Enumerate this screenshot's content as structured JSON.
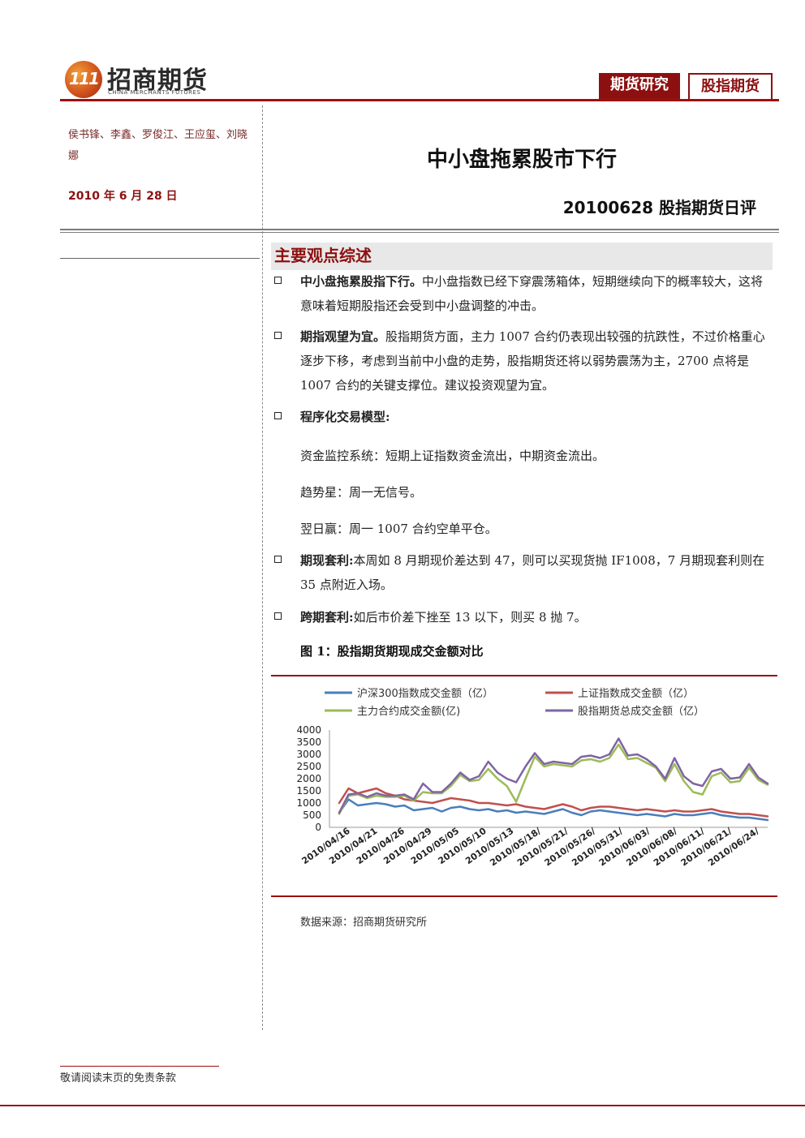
{
  "header": {
    "logo_mark": "111",
    "logo_cn": "招商期货",
    "logo_en": "CHINA MERCHANTS FUTURES",
    "tag1": "期货研究",
    "tag2": "股指期货"
  },
  "left": {
    "authors": "侯书锋、李鑫、罗俊江、王应玺、刘晓娜",
    "date": "2010 年 6 月 28 日"
  },
  "title": "中小盘拖累股市下行",
  "subtitle": "20100628 股指期货日评",
  "section_title": "主要观点综述",
  "points": [
    {
      "head": "中小盘拖累股指下行。",
      "body": "中小盘指数已经下穿震荡箱体，短期继续向下的概率较大，这将意味着短期股指还会受到中小盘调整的冲击。"
    },
    {
      "head": "期指观望为宜。",
      "body": "股指期货方面，主力 1007 合约仍表现出较强的抗跌性，不过价格重心逐步下移，考虑到当前中小盘的走势，股指期货还将以弱势震荡为主，2700 点将是 1007 合约的关键支撑位。建议投资观望为宜。"
    },
    {
      "head": "程序化交易模型:",
      "body": ""
    },
    {
      "head": "期现套利:",
      "body": "本周如 8 月期现价差达到 47，则可以买现货抛 IF1008，7 月期现套利则在 35 点附近入场。"
    },
    {
      "head": "跨期套利:",
      "body": "如后市价差下挫至 13 以下，则买 8 抛 7。"
    }
  ],
  "models": [
    "资金监控系统：短期上证指数资金流出，中期资金流出。",
    "趋势星：周一无信号。",
    "翌日赢：周一 1007 合约空单平仓。"
  ],
  "figure": {
    "title": "图 1：股指期货期现成交金额对比",
    "source": "数据来源：招商期货研究所"
  },
  "footer": "敬请阅读末页的免责条款",
  "chart_data": {
    "type": "line",
    "x": [
      "2010/04/16",
      "2010/04/19",
      "2010/04/20",
      "2010/04/21",
      "2010/04/22",
      "2010/04/23",
      "2010/04/26",
      "2010/04/27",
      "2010/04/28",
      "2010/04/29",
      "2010/04/30",
      "2010/05/04",
      "2010/05/05",
      "2010/05/06",
      "2010/05/07",
      "2010/05/10",
      "2010/05/11",
      "2010/05/12",
      "2010/05/13",
      "2010/05/14",
      "2010/05/17",
      "2010/05/18",
      "2010/05/19",
      "2010/05/20",
      "2010/05/21",
      "2010/05/24",
      "2010/05/25",
      "2010/05/26",
      "2010/05/27",
      "2010/05/28",
      "2010/05/31",
      "2010/06/01",
      "2010/06/02",
      "2010/06/03",
      "2010/06/04",
      "2010/06/07",
      "2010/06/08",
      "2010/06/09",
      "2010/06/10",
      "2010/06/11",
      "2010/06/17",
      "2010/06/18",
      "2010/06/21",
      "2010/06/22",
      "2010/06/23",
      "2010/06/24",
      "2010/06/25"
    ],
    "xtick_labels": [
      "2010/04/16",
      "2010/04/21",
      "2010/04/26",
      "2010/04/29",
      "2010/05/05",
      "2010/05/10",
      "2010/05/13",
      "2010/05/18/",
      "2010/05/21/",
      "2010/05/26/",
      "2010/05/31/",
      "2010/06/03/",
      "2010/06/08/",
      "2010/06/11/",
      "2010/06/21/",
      "2010/06/24/"
    ],
    "ylim": [
      0,
      4000
    ],
    "yticks": [
      0,
      500,
      1000,
      1500,
      2000,
      2500,
      3000,
      3500,
      4000
    ],
    "legend_position": "top",
    "series": [
      {
        "name": "沪深300指数成交金额（亿）",
        "color": "#4a7ebb",
        "values": [
          600,
          1150,
          900,
          950,
          1000,
          950,
          850,
          900,
          700,
          750,
          800,
          650,
          800,
          850,
          750,
          700,
          750,
          650,
          700,
          600,
          650,
          600,
          550,
          650,
          750,
          600,
          500,
          650,
          700,
          650,
          600,
          550,
          500,
          550,
          500,
          450,
          550,
          500,
          500,
          550,
          600,
          500,
          450,
          400,
          400,
          350,
          300
        ]
      },
      {
        "name": "上证指数成交金额（亿）",
        "color": "#c0504d",
        "values": [
          1000,
          1600,
          1400,
          1500,
          1600,
          1400,
          1300,
          1150,
          1100,
          1050,
          1000,
          1100,
          1200,
          1150,
          1100,
          1000,
          1000,
          950,
          900,
          950,
          850,
          800,
          750,
          850,
          950,
          850,
          700,
          800,
          850,
          850,
          800,
          750,
          700,
          750,
          700,
          650,
          700,
          650,
          650,
          700,
          750,
          650,
          600,
          550,
          550,
          500,
          450
        ]
      },
      {
        "name": "主力合约成交金额(亿)",
        "color": "#9bbb59",
        "values": [
          550,
          1300,
          1350,
          1200,
          1300,
          1250,
          1250,
          1300,
          1100,
          1450,
          1400,
          1400,
          1700,
          2150,
          1900,
          1950,
          2400,
          2000,
          1700,
          1050,
          2000,
          2900,
          2500,
          2600,
          2550,
          2500,
          2750,
          2800,
          2700,
          2850,
          3400,
          2800,
          2850,
          2650,
          2450,
          1900,
          2600,
          1900,
          1450,
          1350,
          2100,
          2250,
          1850,
          1900,
          2450,
          1950,
          1750
        ]
      },
      {
        "name": "股指期货总成交金额（亿）",
        "color": "#8064a2",
        "values": [
          600,
          1350,
          1400,
          1250,
          1400,
          1300,
          1300,
          1350,
          1150,
          1800,
          1450,
          1450,
          1800,
          2250,
          1950,
          2100,
          2700,
          2250,
          2000,
          1850,
          2500,
          3050,
          2600,
          2700,
          2650,
          2600,
          2900,
          2950,
          2850,
          3000,
          3650,
          2950,
          3000,
          2800,
          2500,
          2000,
          2850,
          2100,
          1800,
          1700,
          2300,
          2400,
          2000,
          2050,
          2600,
          2050,
          1800
        ]
      }
    ]
  }
}
